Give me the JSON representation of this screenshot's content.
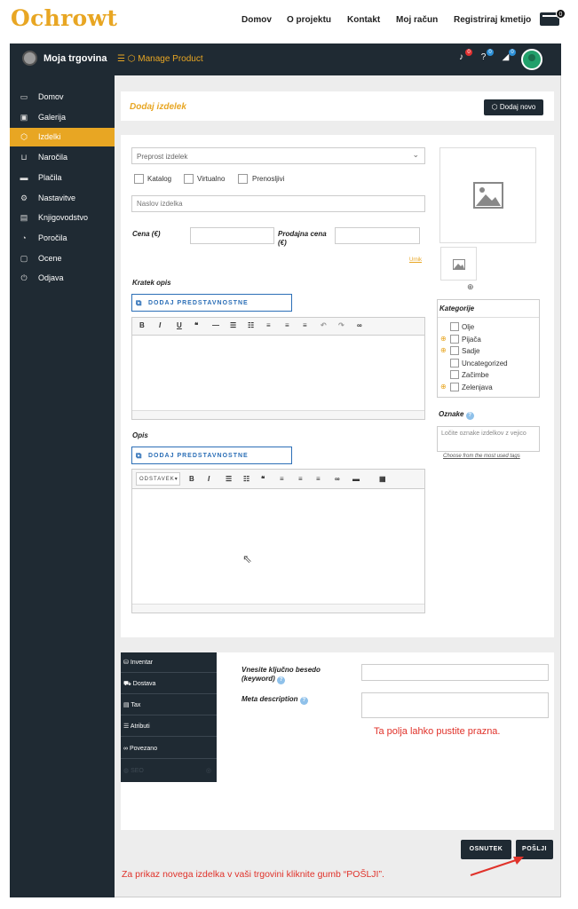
{
  "site": {
    "logo": "Ochrowt",
    "nav": [
      "Domov",
      "O projektu",
      "Kontakt",
      "Moj račun",
      "Registriraj kmetijo"
    ],
    "cart_count": "0"
  },
  "app": {
    "store_name": "Moja trgovina",
    "manage_product": "Manage Product",
    "badges": [
      "0",
      "0",
      "0"
    ]
  },
  "sidebar": {
    "items": [
      {
        "label": "Domov",
        "icon": "monitor-icon"
      },
      {
        "label": "Galerija",
        "icon": "image-icon"
      },
      {
        "label": "Izdelki",
        "icon": "box-icon",
        "active": true
      },
      {
        "label": "Naročila",
        "icon": "cart-icon"
      },
      {
        "label": "Plačila",
        "icon": "credit-card-icon"
      },
      {
        "label": "Nastavitve",
        "icon": "gears-icon"
      },
      {
        "label": "Knjigovodstvo",
        "icon": "money-icon"
      },
      {
        "label": "Poročila",
        "icon": "pie-chart-icon"
      },
      {
        "label": "Ocene",
        "icon": "comment-icon"
      },
      {
        "label": "Odjava",
        "icon": "power-icon"
      }
    ]
  },
  "header": {
    "title": "Dodaj izdelek",
    "add_new": "Dodaj novo"
  },
  "form": {
    "product_type": "Preprost izdelek",
    "checkboxes": [
      "Katalog",
      "Virtualno",
      "Prenosljivi"
    ],
    "title_placeholder": "Naslov izdelka",
    "price_label": "Cena (€)",
    "sale_price_label": "Prodajna cena (€)",
    "schedule_link": "Urnik",
    "short_desc_label": "Kratek opis",
    "media_button": "DODAJ PREDSTAVNOSTNE DATOTEKE",
    "desc_label": "Opis",
    "paragraph_select": "ODSTAVEK"
  },
  "categories": {
    "title": "Kategorije",
    "items": [
      {
        "label": "Olje",
        "expandable": false
      },
      {
        "label": "Pijača",
        "expandable": true
      },
      {
        "label": "Sadje",
        "expandable": true
      },
      {
        "label": "Uncategorized",
        "expandable": false
      },
      {
        "label": "Začimbe",
        "expandable": false
      },
      {
        "label": "Zelenjava",
        "expandable": true
      }
    ]
  },
  "tags": {
    "title": "Oznake",
    "placeholder": "Ločite oznake izdelkov z vejico",
    "link": "Choose from the most used tags"
  },
  "tabs": [
    "Inventar",
    "Dostava",
    "Tax",
    "Atributi",
    "Povezano",
    "SEO"
  ],
  "seo": {
    "keyword_label": "Vnesite ključno besedo (keyword)",
    "meta_label": "Meta description"
  },
  "notes": {
    "fields_empty": "Ta polja lahko pustite prazna.",
    "submit_hint": "Za prikaz novega izdelka v vaši trgovini kliknite gumb “POŠLJI”."
  },
  "actions": {
    "draft": "OSNUTEK",
    "submit": "POŠLJI"
  },
  "colors": {
    "accent": "#e8a623",
    "dark": "#1f2a33",
    "note": "#e0322a"
  }
}
